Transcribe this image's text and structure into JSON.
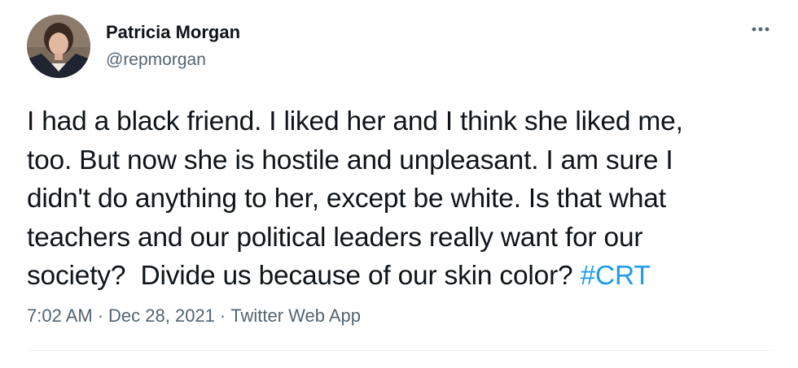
{
  "author": {
    "name": "Patricia Morgan",
    "handle": "@repmorgan",
    "avatar_icon": "profile-photo"
  },
  "tweet": {
    "lines": [
      "I had a black friend. I liked her and I think she liked me,",
      "too. But now she is hostile and unpleasant. I am sure I",
      "didn't do anything to her, except be white. Is that what",
      "teachers and our political leaders really want for our",
      "society?  Divide us because of our skin color? "
    ],
    "hashtag": "#CRT"
  },
  "meta": {
    "time": "7:02 AM",
    "separator": "·",
    "date": "Dec 28, 2021",
    "source": "Twitter Web App"
  },
  "colors": {
    "text": "#0f1419",
    "secondary": "#536471",
    "link": "#1d9bf0",
    "divider": "#eff3f4"
  },
  "icons": {
    "more": "more-horizontal-icon"
  }
}
